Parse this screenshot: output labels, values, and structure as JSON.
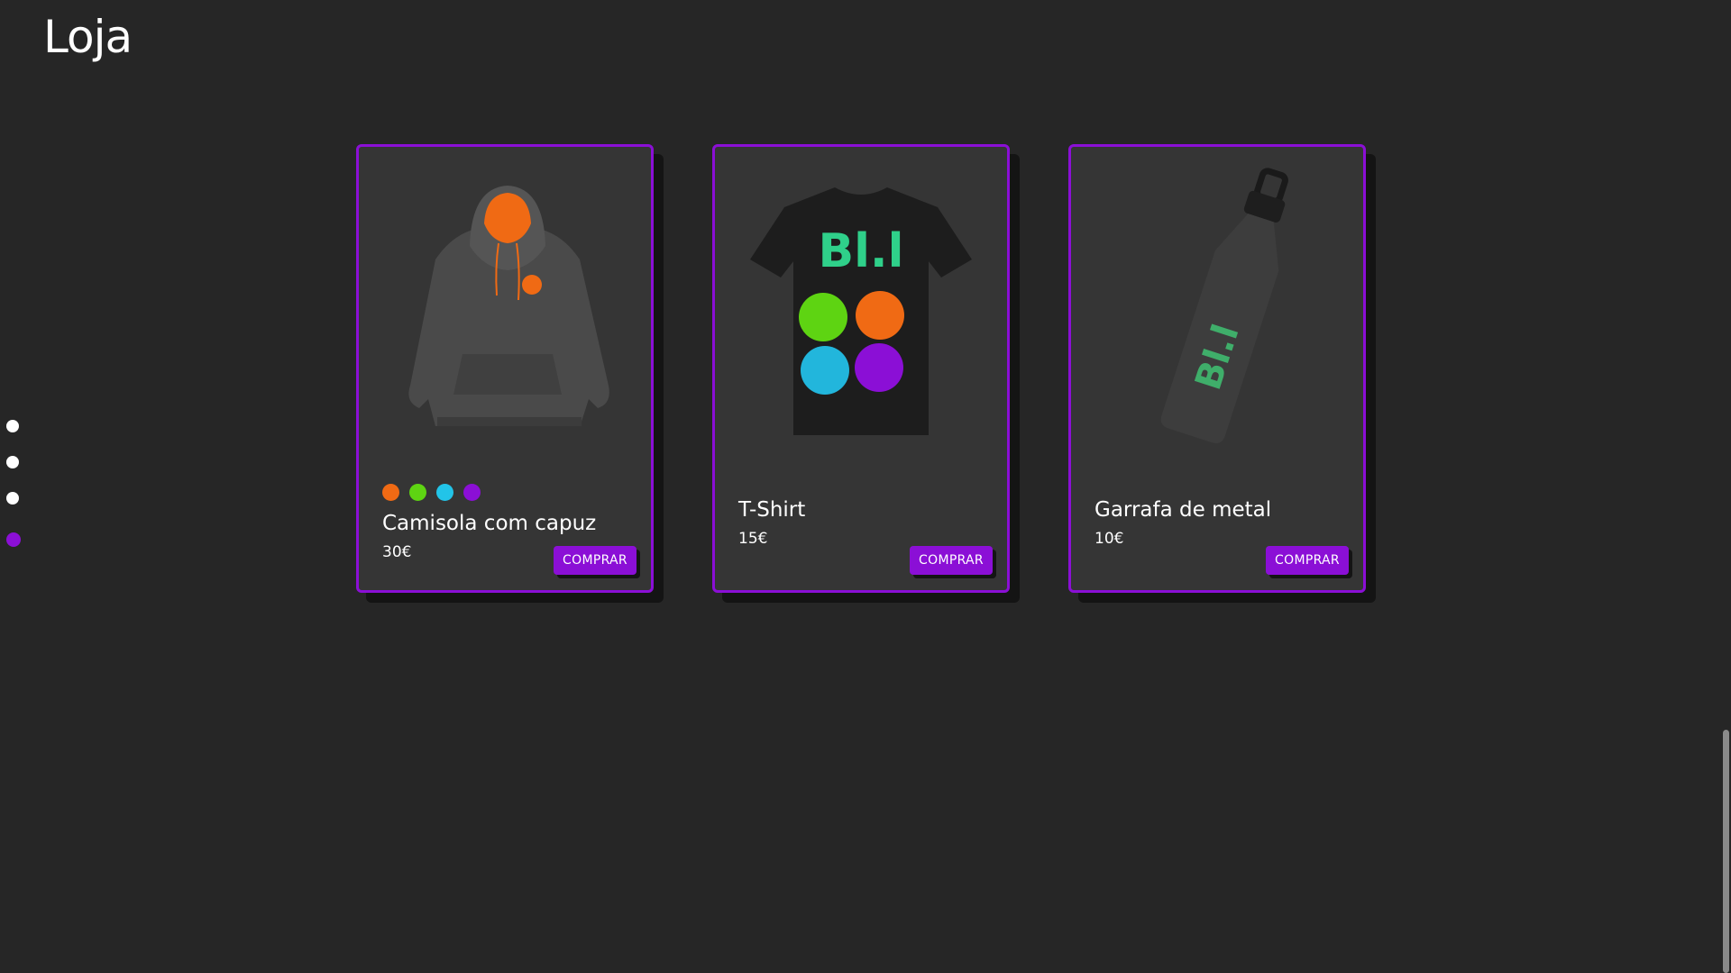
{
  "page": {
    "title": "Loja"
  },
  "side_nav": {
    "items": [
      {
        "color": "#ffffff",
        "active": false
      },
      {
        "color": "#ffffff",
        "active": false
      },
      {
        "color": "#ffffff",
        "active": false
      },
      {
        "color": "#8b0fd6",
        "active": true
      }
    ]
  },
  "products": [
    {
      "name": "Camisola com capuz",
      "price": "30€",
      "buy_label": "COMPRAR",
      "image_icon": "hoodie-icon",
      "colors": [
        "#f06a14",
        "#5ed412",
        "#22c4e8",
        "#8b0fd6"
      ]
    },
    {
      "name": "T-Shirt",
      "price": "15€",
      "buy_label": "COMPRAR",
      "image_icon": "tshirt-icon",
      "image_text": "Bl.l"
    },
    {
      "name": "Garrafa de metal",
      "price": "10€",
      "buy_label": "COMPRAR",
      "image_icon": "bottle-icon",
      "image_text": "Bl.l"
    }
  ],
  "theme": {
    "background": "#262626",
    "card_background": "#353535",
    "accent": "#8b0fd6"
  }
}
